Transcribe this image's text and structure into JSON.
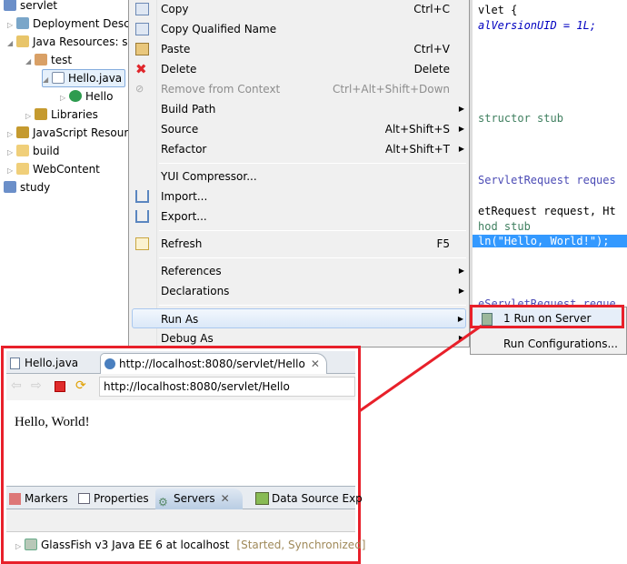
{
  "tree": {
    "items": [
      {
        "label": "servlet"
      },
      {
        "label": "Deployment Descriptor"
      },
      {
        "label": "Java Resources: src"
      },
      {
        "label": "test"
      },
      {
        "label": "Hello.java"
      },
      {
        "label": "Hello"
      },
      {
        "label": "Libraries"
      },
      {
        "label": "JavaScript Resources"
      },
      {
        "label": "build"
      },
      {
        "label": "WebContent"
      },
      {
        "label": "study"
      }
    ]
  },
  "code": {
    "lines": [
      "vlet {",
      "alVersionUID = 1L;",
      "structor stub",
      "ServletRequest reques",
      "etRequest request, Ht",
      "hod stub",
      "ln(\"Hello, World!\");",
      "eServletRequest reque"
    ]
  },
  "menu": {
    "items": [
      {
        "label": "Copy",
        "shortcut": "Ctrl+C"
      },
      {
        "label": "Copy Qualified Name",
        "shortcut": ""
      },
      {
        "label": "Paste",
        "shortcut": "Ctrl+V"
      },
      {
        "label": "Delete",
        "shortcut": "Delete"
      },
      {
        "label": "Remove from Context",
        "shortcut": "Ctrl+Alt+Shift+Down"
      },
      {
        "label": "Build Path",
        "shortcut": ""
      },
      {
        "label": "Source",
        "shortcut": "Alt+Shift+S"
      },
      {
        "label": "Refactor",
        "shortcut": "Alt+Shift+T"
      },
      {
        "label": "YUI Compressor...",
        "shortcut": ""
      },
      {
        "label": "Import...",
        "shortcut": ""
      },
      {
        "label": "Export...",
        "shortcut": ""
      },
      {
        "label": "Refresh",
        "shortcut": "F5"
      },
      {
        "label": "References",
        "shortcut": ""
      },
      {
        "label": "Declarations",
        "shortcut": ""
      },
      {
        "label": "Run As",
        "shortcut": ""
      },
      {
        "label": "Debug As",
        "shortcut": ""
      }
    ]
  },
  "submenu": {
    "items": [
      {
        "label": "1 Run on Server"
      },
      {
        "label": "Run Configurations..."
      }
    ]
  },
  "browser": {
    "tab_file": "Hello.java",
    "tab_url": "http://localhost:8080/servlet/Hello",
    "url": "http://localhost:8080/servlet/Hello",
    "content": "Hello, World!"
  },
  "views": {
    "tabs": [
      "Markers",
      "Properties",
      "Servers",
      "Data Source Exp"
    ],
    "server_name": "GlassFish v3 Java EE 6 at localhost",
    "server_status": "[Started, Synchronized]"
  },
  "colors": {
    "highlight": "#e8202a",
    "selection": "#3399ff"
  }
}
